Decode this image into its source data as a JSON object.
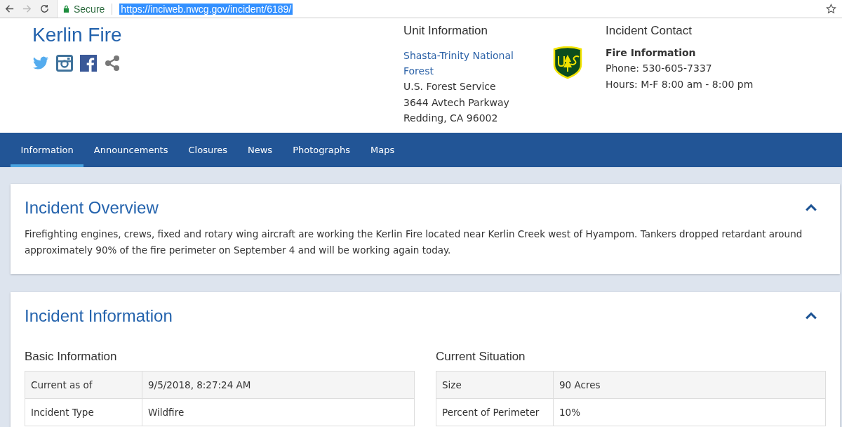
{
  "browser": {
    "secure_label": "Secure",
    "url": "https://inciweb.nwcg.gov/incident/6189/"
  },
  "header": {
    "title": "Kerlin Fire",
    "unit": {
      "heading": "Unit Information",
      "link": "Shasta-Trinity National Forest",
      "lines": [
        "U.S. Forest Service",
        "3644 Avtech Parkway",
        "Redding, CA 96002"
      ]
    },
    "contact": {
      "heading": "Incident Contact",
      "name": "Fire Information",
      "lines": [
        "Phone: 530-605-7337",
        "Hours: M-F 8:00 am - 8:00 pm"
      ]
    }
  },
  "tabs": [
    {
      "label": "Information",
      "selected": true
    },
    {
      "label": "Announcements",
      "selected": false
    },
    {
      "label": "Closures",
      "selected": false
    },
    {
      "label": "News",
      "selected": false
    },
    {
      "label": "Photographs",
      "selected": false
    },
    {
      "label": "Maps",
      "selected": false
    }
  ],
  "overview": {
    "title": "Incident Overview",
    "expanded": true,
    "text": "Firefighting engines, crews, fixed and rotary wing aircraft are working the Kerlin Fire located near Kerlin Creek west of Hyampom. Tankers dropped retardant around approximately 90% of the fire perimeter on September 4 and will be working again today."
  },
  "information": {
    "title": "Incident Information",
    "expanded": true,
    "tables": [
      {
        "heading": "Basic Information",
        "rows": [
          [
            "Current as of",
            "9/5/2018, 8:27:24 AM"
          ],
          [
            "Incident Type",
            "Wildfire"
          ]
        ]
      },
      {
        "heading": "Current Situation",
        "rows": [
          [
            "Size",
            "90 Acres"
          ],
          [
            "Percent of Perimeter",
            "10%"
          ]
        ]
      }
    ]
  }
}
